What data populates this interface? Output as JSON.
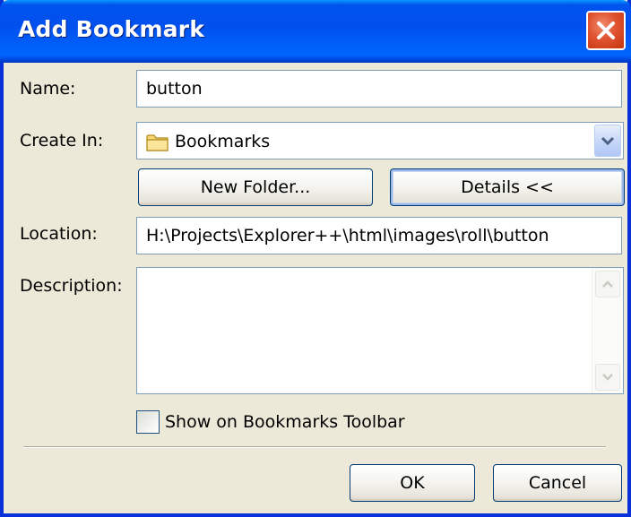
{
  "window": {
    "title": "Add Bookmark"
  },
  "form": {
    "name_label": "Name:",
    "name_value": "button",
    "create_in_label": "Create In:",
    "create_in_value": "Bookmarks",
    "new_folder_button": "New Folder...",
    "details_button": "Details <<",
    "location_label": "Location:",
    "location_value": "H:\\Projects\\Explorer++\\html\\images\\roll\\button",
    "description_label": "Description:",
    "description_value": "",
    "show_toolbar_label": "Show on Bookmarks Toolbar",
    "show_toolbar_checked": false
  },
  "footer": {
    "ok_button": "OK",
    "cancel_button": "Cancel"
  },
  "icons": {
    "close": "close-icon",
    "folder": "folder-icon",
    "dropdown": "chevron-down-icon",
    "scroll_up": "scroll-up-icon",
    "scroll_down": "scroll-down-icon"
  },
  "colors": {
    "titlebar": "#0054e3",
    "close_button": "#e0532f",
    "window_bg": "#ece9d8",
    "field_border": "#7f9db9"
  }
}
